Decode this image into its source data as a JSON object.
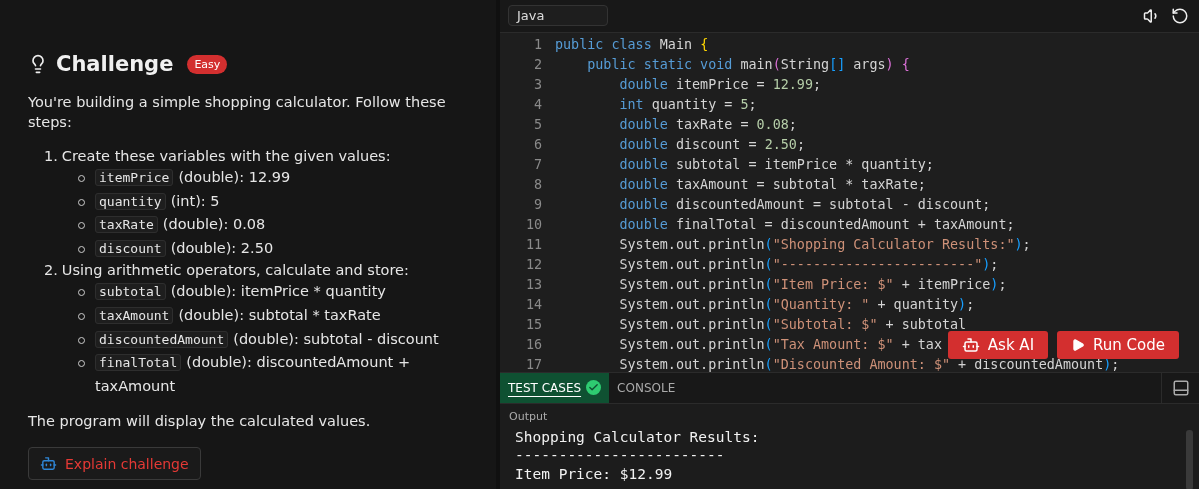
{
  "challenge": {
    "title": "Challenge",
    "difficulty": "Easy",
    "intro": "You're building a simple shopping calculator. Follow these steps:",
    "steps": [
      {
        "number": "1.",
        "text": "Create these variables with the given values:",
        "items": [
          {
            "code": "itemPrice",
            "text": "(double): 12.99"
          },
          {
            "code": "quantity",
            "text": "(int): 5"
          },
          {
            "code": "taxRate",
            "text": "(double): 0.08"
          },
          {
            "code": "discount",
            "text": "(double): 2.50"
          }
        ]
      },
      {
        "number": "2.",
        "text": "Using arithmetic operators, calculate and store:",
        "items": [
          {
            "code": "subtotal",
            "text": "(double): itemPrice * quantity"
          },
          {
            "code": "taxAmount",
            "text": "(double): subtotal * taxRate"
          },
          {
            "code": "discountedAmount",
            "text": "(double): subtotal - discount"
          },
          {
            "code": "finalTotal",
            "text": "(double): discountedAmount + taxAmount"
          }
        ]
      }
    ],
    "outro": "The program will display the calculated values.",
    "explain_button": "Explain challenge"
  },
  "editor": {
    "language": "Java",
    "lines": [
      {
        "number": "1",
        "tokens": [
          {
            "kind": "keyword",
            "text": "public class"
          },
          {
            "kind": "plain",
            "text": " Main "
          },
          {
            "kind": "brace1",
            "text": "{"
          }
        ]
      },
      {
        "number": "2",
        "tokens": [
          {
            "kind": "keyword",
            "text": "    public static void"
          },
          {
            "kind": "plain",
            "text": " main"
          },
          {
            "kind": "brace2",
            "text": "("
          },
          {
            "kind": "plain",
            "text": "String"
          },
          {
            "kind": "brace3",
            "text": "[]"
          },
          {
            "kind": "plain",
            "text": " args"
          },
          {
            "kind": "brace2",
            "text": ") {"
          }
        ]
      },
      {
        "number": "3",
        "tokens": [
          {
            "kind": "keyword",
            "text": "        double"
          },
          {
            "kind": "plain",
            "text": " itemPrice = "
          },
          {
            "kind": "number",
            "text": "12.99"
          },
          {
            "kind": "plain",
            "text": ";"
          }
        ]
      },
      {
        "number": "4",
        "tokens": [
          {
            "kind": "keyword",
            "text": "        int"
          },
          {
            "kind": "plain",
            "text": " quantity = "
          },
          {
            "kind": "number",
            "text": "5"
          },
          {
            "kind": "plain",
            "text": ";"
          }
        ]
      },
      {
        "number": "5",
        "tokens": [
          {
            "kind": "keyword",
            "text": "        double"
          },
          {
            "kind": "plain",
            "text": " taxRate = "
          },
          {
            "kind": "number",
            "text": "0.08"
          },
          {
            "kind": "plain",
            "text": ";"
          }
        ]
      },
      {
        "number": "6",
        "tokens": [
          {
            "kind": "keyword",
            "text": "        double"
          },
          {
            "kind": "plain",
            "text": " discount = "
          },
          {
            "kind": "number",
            "text": "2.50"
          },
          {
            "kind": "plain",
            "text": ";"
          }
        ]
      },
      {
        "number": "7",
        "tokens": [
          {
            "kind": "keyword",
            "text": "        double"
          },
          {
            "kind": "plain",
            "text": " subtotal = itemPrice * quantity;"
          }
        ]
      },
      {
        "number": "8",
        "tokens": [
          {
            "kind": "keyword",
            "text": "        double"
          },
          {
            "kind": "plain",
            "text": " taxAmount = subtotal * taxRate;"
          }
        ]
      },
      {
        "number": "9",
        "tokens": [
          {
            "kind": "keyword",
            "text": "        double"
          },
          {
            "kind": "plain",
            "text": " discountedAmount = subtotal - discount;"
          }
        ]
      },
      {
        "number": "10",
        "tokens": [
          {
            "kind": "keyword",
            "text": "        double"
          },
          {
            "kind": "plain",
            "text": " finalTotal = discountedAmount + taxAmount;"
          }
        ]
      },
      {
        "number": "11",
        "tokens": [
          {
            "kind": "plain",
            "text": "        System.out.println"
          },
          {
            "kind": "brace3",
            "text": "("
          },
          {
            "kind": "string",
            "text": "\"Shopping Calculator Results:\""
          },
          {
            "kind": "brace3",
            "text": ")"
          },
          {
            "kind": "plain",
            "text": ";"
          }
        ]
      },
      {
        "number": "12",
        "tokens": [
          {
            "kind": "plain",
            "text": "        System.out.println"
          },
          {
            "kind": "brace3",
            "text": "("
          },
          {
            "kind": "string",
            "text": "\"------------------------\""
          },
          {
            "kind": "brace3",
            "text": ")"
          },
          {
            "kind": "plain",
            "text": ";"
          }
        ]
      },
      {
        "number": "13",
        "tokens": [
          {
            "kind": "plain",
            "text": "        System.out.println"
          },
          {
            "kind": "brace3",
            "text": "("
          },
          {
            "kind": "string",
            "text": "\"Item Price: $\""
          },
          {
            "kind": "plain",
            "text": " + itemPrice"
          },
          {
            "kind": "brace3",
            "text": ")"
          },
          {
            "kind": "plain",
            "text": ";"
          }
        ]
      },
      {
        "number": "14",
        "tokens": [
          {
            "kind": "plain",
            "text": "        System.out.println"
          },
          {
            "kind": "brace3",
            "text": "("
          },
          {
            "kind": "string",
            "text": "\"Quantity: \""
          },
          {
            "kind": "plain",
            "text": " + quantity"
          },
          {
            "kind": "brace3",
            "text": ")"
          },
          {
            "kind": "plain",
            "text": ";"
          }
        ]
      },
      {
        "number": "15",
        "tokens": [
          {
            "kind": "plain",
            "text": "        System.out.println"
          },
          {
            "kind": "brace3",
            "text": "("
          },
          {
            "kind": "string",
            "text": "\"Subtotal: $\""
          },
          {
            "kind": "plain",
            "text": " + subtotal"
          }
        ]
      },
      {
        "number": "16",
        "tokens": [
          {
            "kind": "plain",
            "text": "        System.out.println"
          },
          {
            "kind": "brace3",
            "text": "("
          },
          {
            "kind": "string",
            "text": "\"Tax Amount: $\""
          },
          {
            "kind": "plain",
            "text": " + tax"
          }
        ]
      },
      {
        "number": "17",
        "tokens": [
          {
            "kind": "plain",
            "text": "        System.out.println"
          },
          {
            "kind": "brace3",
            "text": "("
          },
          {
            "kind": "string",
            "text": "\"Discounted Amount: $\""
          },
          {
            "kind": "plain",
            "text": " + discountedAmount"
          },
          {
            "kind": "brace3",
            "text": ")"
          },
          {
            "kind": "plain",
            "text": ";"
          }
        ]
      }
    ],
    "ask_button": "Ask AI",
    "run_button": "Run Code"
  },
  "tabs": [
    {
      "label": "TEST CASES",
      "selected": true,
      "passed": true
    },
    {
      "label": "CONSOLE",
      "selected": false,
      "passed": false
    }
  ],
  "output": {
    "label": "Output",
    "lines": [
      "Shopping Calculator Results:",
      "------------------------",
      "Item Price: $12.99"
    ]
  }
}
